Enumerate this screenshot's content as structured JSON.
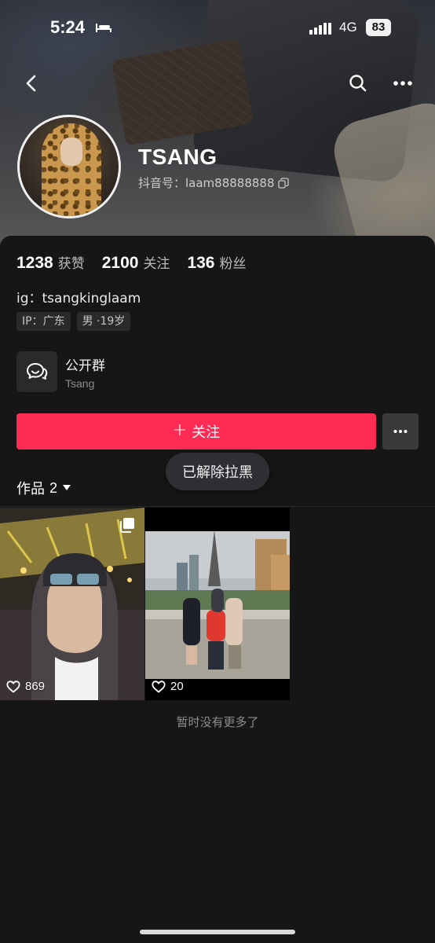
{
  "status_bar": {
    "time": "5:24",
    "network": "4G",
    "battery": "83"
  },
  "profile": {
    "name": "TSANG",
    "douyin_id": "抖音号：laam88888888",
    "stats": [
      {
        "value": "1238",
        "label": "获赞"
      },
      {
        "value": "2100",
        "label": "关注"
      },
      {
        "value": "136",
        "label": "粉丝"
      }
    ],
    "bio": "ig：tsangkinglaam",
    "tags": [
      "IP：广东",
      "男 ·19岁"
    ]
  },
  "group": {
    "title": "公开群",
    "subtitle": "Tsang"
  },
  "actions": {
    "follow_label": "关注"
  },
  "toast": "已解除拉黑",
  "works": {
    "label": "作品",
    "count": "2"
  },
  "videos": [
    {
      "likes": "869"
    },
    {
      "likes": "20"
    }
  ],
  "footer": {
    "no_more": "暂时没有更多了"
  },
  "colors": {
    "accent": "#fe2c55",
    "background": "#161616"
  }
}
